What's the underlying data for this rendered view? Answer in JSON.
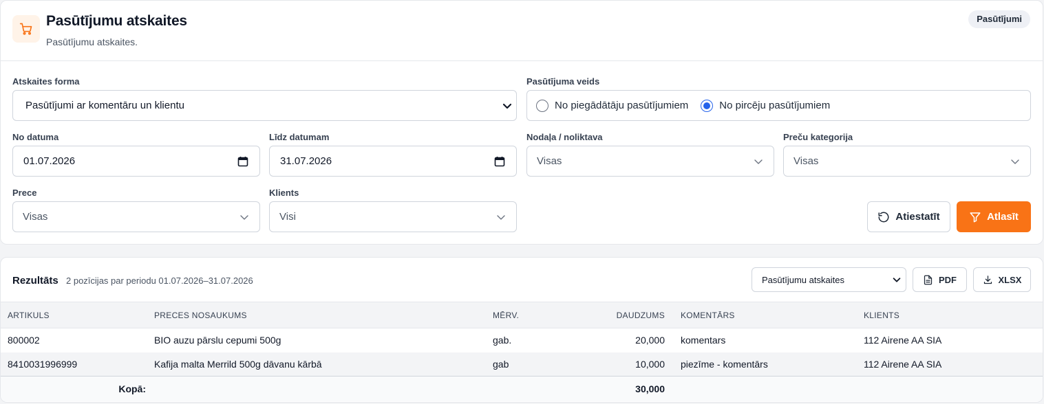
{
  "header": {
    "title": "Pasūtījumu atskaites",
    "subtitle": "Pasūtījumu atskaites.",
    "badge": "Pasūtījumi",
    "icon": "cart-icon"
  },
  "form": {
    "report_form_label": "Atskaites forma",
    "report_form_value": "Pasūtījumi ar komentāru un klientu",
    "order_type_label": "Pasūtījuma veids",
    "order_type_options": [
      "No piegādātāju pasūtījumiem",
      "No pircēju pasūtījumiem"
    ],
    "order_type_selected": 1,
    "date_from_label": "No datuma",
    "date_from_value": "01.07.2026",
    "date_to_label": "Līdz datumam",
    "date_to_value": "31.07.2026",
    "department_label": "Nodaļa / noliktava",
    "department_value": "Visas",
    "category_label": "Preču kategorija",
    "category_value": "Visas",
    "product_label": "Prece",
    "product_value": "Visas",
    "client_label": "Klients",
    "client_value": "Visi",
    "reset_label": "Atiestatīt",
    "apply_label": "Atlasīt"
  },
  "results": {
    "title": "Rezultāts",
    "summary": "2 pozīcijas par periodu 01.07.2026–31.07.2026",
    "export_select_value": "Pasūtījumu atskaites",
    "pdf_label": "PDF",
    "xlsx_label": "XLSX",
    "columns": [
      "ARTIKULS",
      "PRECES NOSAUKUMS",
      "MĒRV.",
      "DAUDZUMS",
      "KOMENTĀRS",
      "KLIENTS"
    ],
    "rows": [
      [
        "800002",
        "BIO auzu pārslu cepumi 500g",
        "gab.",
        "20,000",
        "komentars",
        "112 Airene AA SIA"
      ],
      [
        "8410031996999",
        "Kafija malta Merrild 500g dāvanu kārbā",
        "gab",
        "10,000",
        "piezīme - komentārs",
        "112 Airene AA SIA"
      ]
    ],
    "total_label": "Kopā:",
    "total_value": "30,000"
  },
  "colors": {
    "accent": "#f97316",
    "radio": "#2563eb"
  }
}
